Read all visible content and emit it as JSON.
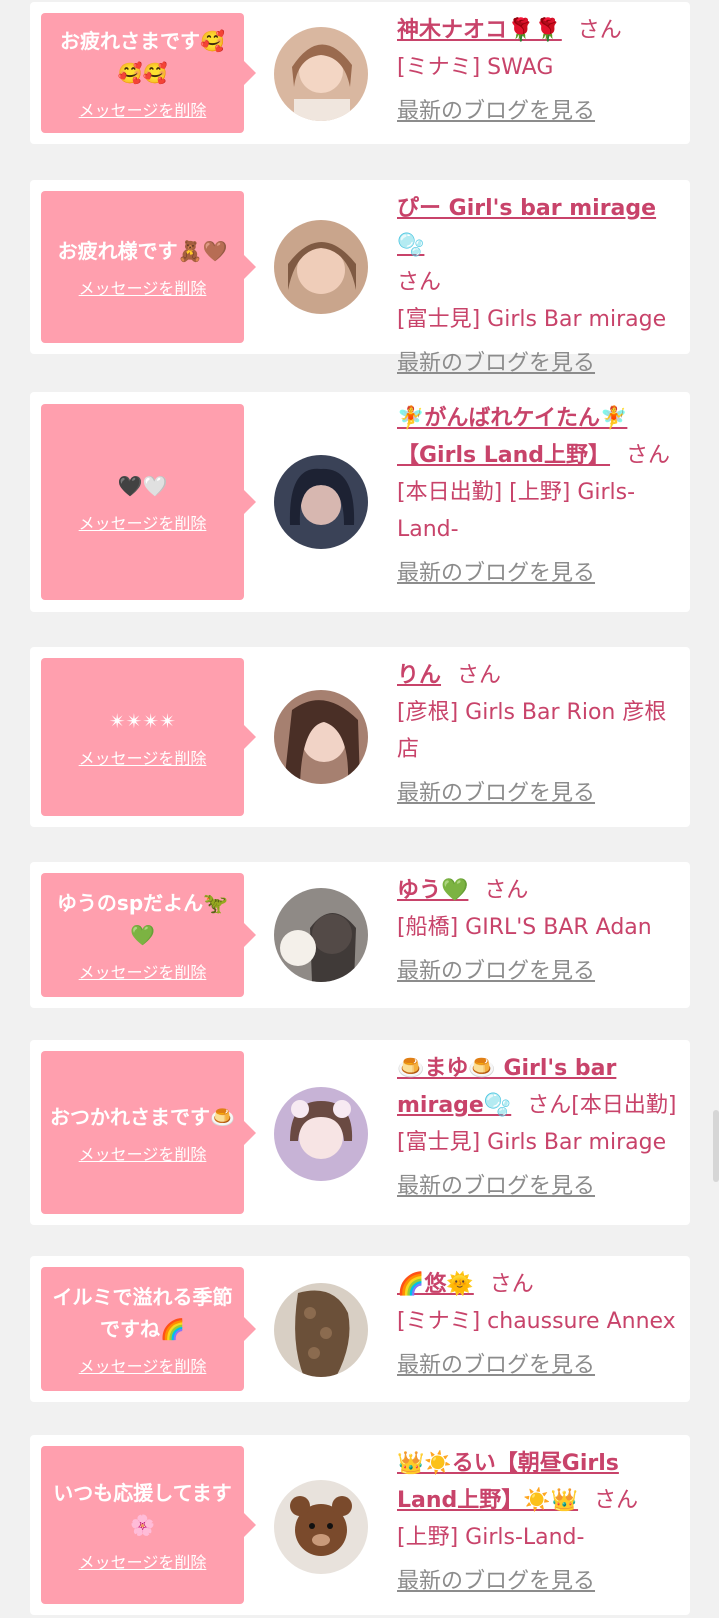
{
  "delete_label": "メッセージを削除",
  "san_label": "さん",
  "blog_label": "最新のブログを見る",
  "items": [
    {
      "message": "お疲れさまです🥰🥰🥰",
      "name": "神木ナオコ🌹🌹",
      "after_san": "",
      "shop": "[ミナミ] SWAG"
    },
    {
      "message": "お疲れ様です🧸🤎",
      "name": "ぴー Girl's bar mirage🫧",
      "after_san": "",
      "shop": "[富士見] Girls Bar mirage"
    },
    {
      "message": "🖤🤍",
      "name": "🧚がんばれケイたん🧚【Girls Land上野】",
      "after_san": "",
      "shop": "[本日出勤] [上野] Girls-Land-"
    },
    {
      "message": "✴✴✴✴",
      "name": "りん",
      "after_san": "",
      "shop": "[彦根] Girls Bar Rion 彦根店"
    },
    {
      "message": "ゆうのspだよん🦖💚",
      "name": "ゆう💚",
      "after_san": "",
      "shop": "[船橋] GIRL'S BAR Adan"
    },
    {
      "message": "おつかれさまです🍮",
      "name": "🍮まゆ🍮 Girl's bar mirage🫧",
      "after_san": "[本日出勤]",
      "shop": "[富士見] Girls Bar mirage"
    },
    {
      "message": "イルミで溢れる季節ですね🌈",
      "name": "🌈悠🌞",
      "after_san": "",
      "shop": "[ミナミ] chaussure Annex"
    },
    {
      "message": "いつも応援してます🌸",
      "name": "👑☀️るい【朝昼Girls Land上野】☀️👑",
      "after_san": "",
      "shop": "[上野] Girls-Land-"
    }
  ]
}
